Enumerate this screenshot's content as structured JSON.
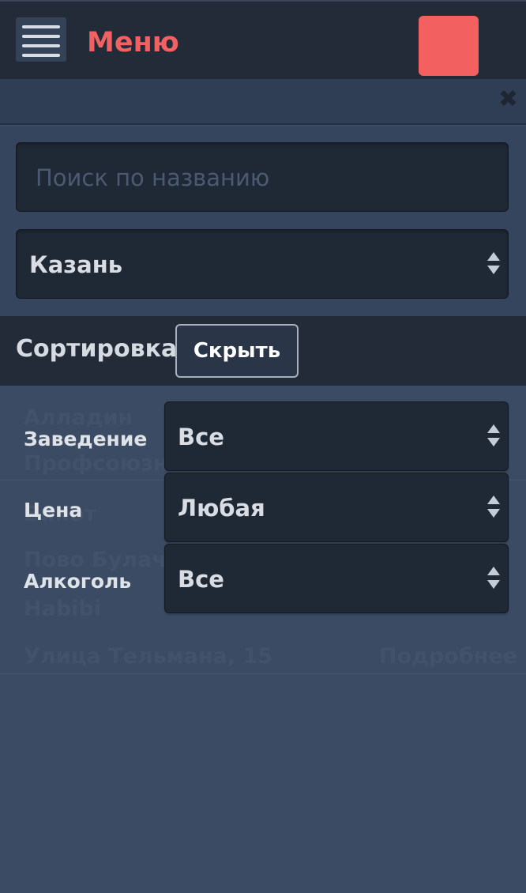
{
  "header": {
    "menu_title": "Меню",
    "accent_color": "#f06262"
  },
  "search": {
    "placeholder": "Поиск по названию"
  },
  "city_select": {
    "value": "Казань"
  },
  "sort_bar": {
    "label": "Сортировка",
    "hide_label": "Скрыть"
  },
  "sort_fields": [
    {
      "label": "Заведение",
      "value": "Все"
    },
    {
      "label": "Цена",
      "value": "Любая"
    },
    {
      "label": "Алкоголь",
      "value": "Все"
    }
  ],
  "background_list": [
    {
      "name": "Алладин",
      "address": "Профсоюзн"
    },
    {
      "name": "Бикот"
    },
    {
      "name": "Пово Булачн"
    },
    {
      "name": "Habibi",
      "address": "Улица Тельмана, 15",
      "details": "Подробнее"
    }
  ]
}
